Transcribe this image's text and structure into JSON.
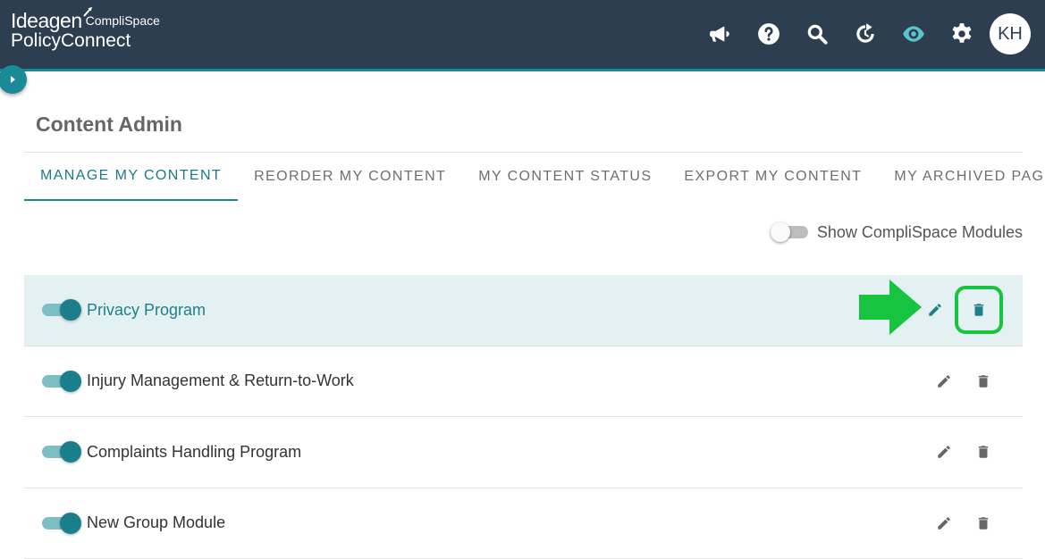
{
  "header": {
    "brand": "Ideagen",
    "brand_sub": "CompliSpace",
    "product": "PolicyConnect",
    "icons": [
      "megaphone-icon",
      "help-icon",
      "search-icon",
      "refresh-icon",
      "eye-icon",
      "gear-icon"
    ],
    "avatar_initials": "KH"
  },
  "page": {
    "title": "Content Admin"
  },
  "tabs": [
    {
      "label": "MANAGE MY CONTENT",
      "active": true
    },
    {
      "label": "REORDER MY CONTENT",
      "active": false
    },
    {
      "label": "MY CONTENT STATUS",
      "active": false
    },
    {
      "label": "EXPORT MY CONTENT",
      "active": false
    },
    {
      "label": "MY ARCHIVED PAGES",
      "active": false
    }
  ],
  "modules_toggle": {
    "label": "Show CompliSpace Modules",
    "on": false
  },
  "modules": [
    {
      "name": "Privacy Program",
      "enabled": true,
      "highlighted": true
    },
    {
      "name": "Injury Management & Return-to-Work",
      "enabled": true,
      "highlighted": false
    },
    {
      "name": "Complaints Handling Program",
      "enabled": true,
      "highlighted": false
    },
    {
      "name": "New Group Module",
      "enabled": true,
      "highlighted": false
    }
  ],
  "colors": {
    "header_bg": "#2c3e50",
    "accent": "#1a8a96",
    "highlight_row": "#e3f1f2",
    "annotation_green": "#16c43f"
  }
}
